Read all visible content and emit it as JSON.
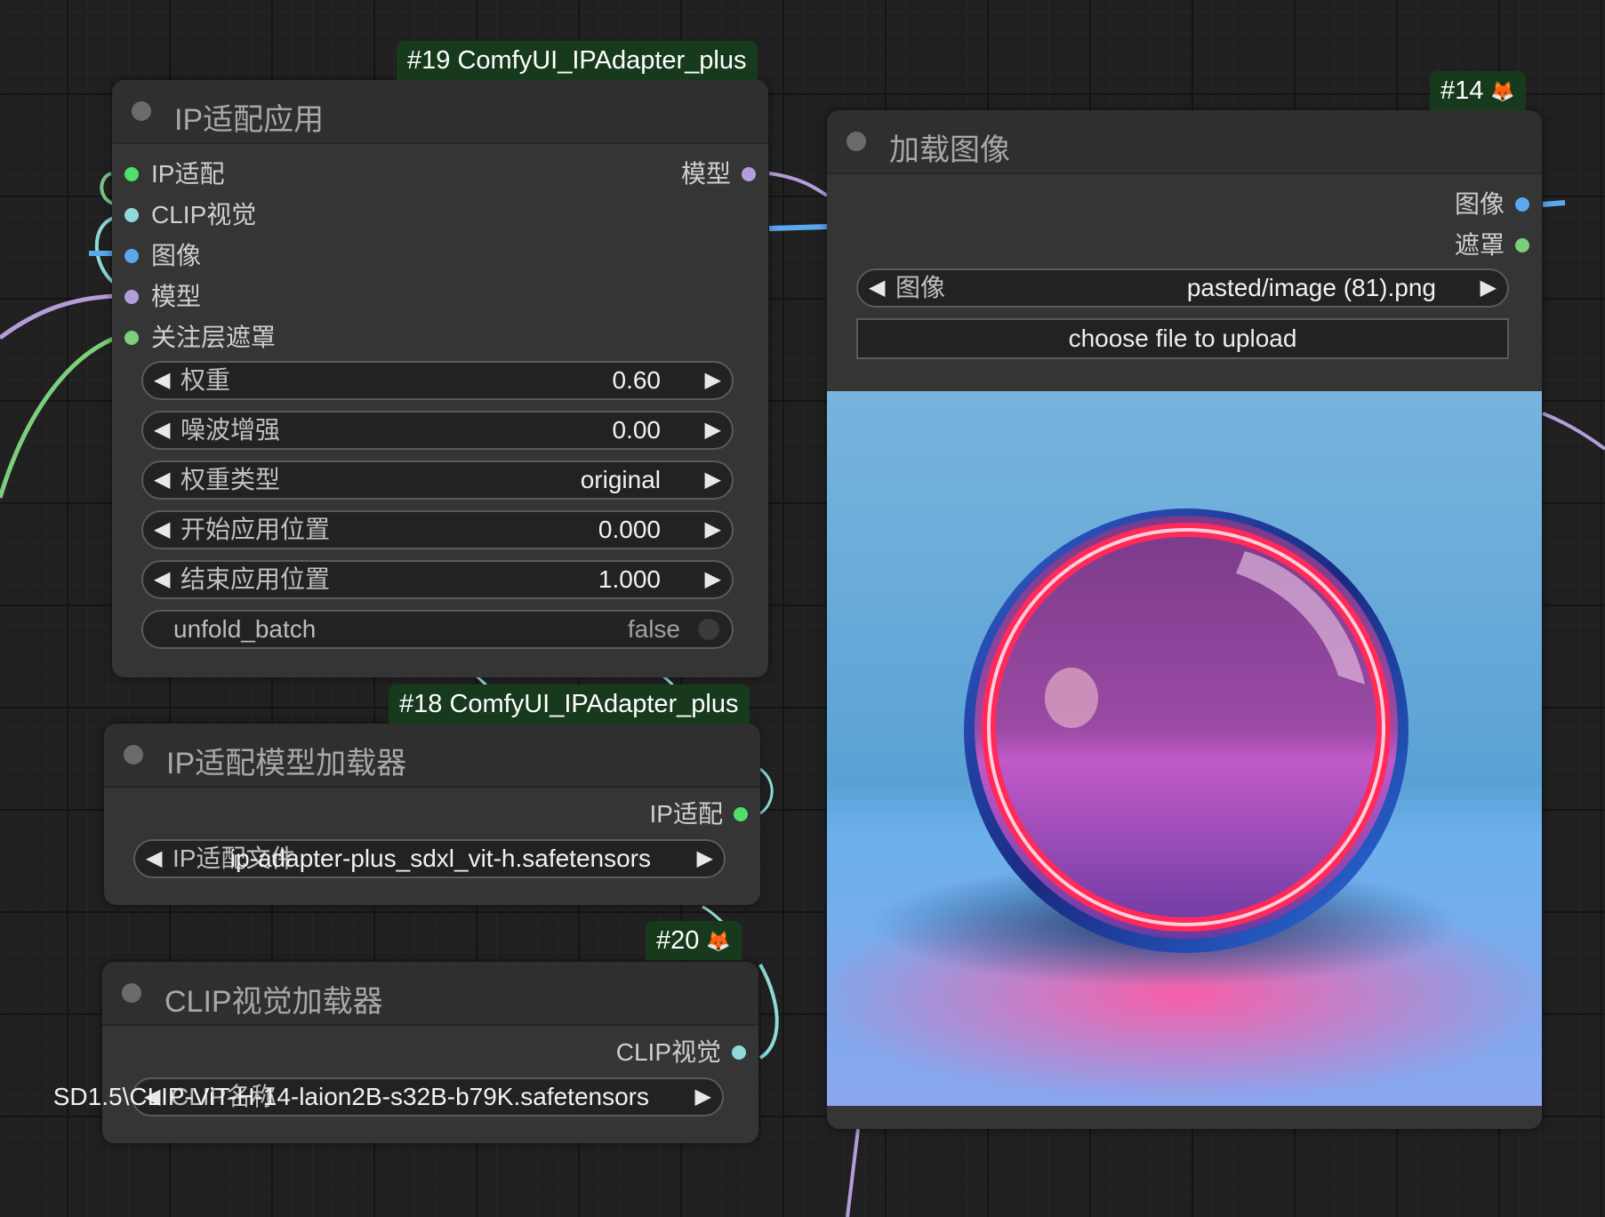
{
  "colors": {
    "canvas_bg": "#202020",
    "node_bg": "#353535",
    "badge_bg": "#17391c",
    "ipadapter_slot": "#4fe06a",
    "clip_vision_slot": "#8fd9d9",
    "image_slot": "#5aa8f0",
    "model_slot": "#b39ddb",
    "mask_slot": "#7ccf7c"
  },
  "node19": {
    "badge": "#19 ComfyUI_IPAdapter_plus",
    "title": "IP适配应用",
    "inputs": [
      "IP适配",
      "CLIP视觉",
      "图像",
      "模型",
      "关注层遮罩"
    ],
    "output": "模型",
    "widgets": [
      {
        "label": "权重",
        "value": "0.60"
      },
      {
        "label": "噪波增强",
        "value": "0.00"
      },
      {
        "label": "权重类型",
        "value": "original"
      },
      {
        "label": "开始应用位置",
        "value": "0.000"
      },
      {
        "label": "结束应用位置",
        "value": "1.000"
      }
    ],
    "toggle": {
      "label": "unfold_batch",
      "value": "false"
    }
  },
  "node18": {
    "badge": "#18 ComfyUI_IPAdapter_plus",
    "title": "IP适配模型加载器",
    "output": "IP适配",
    "widget_label": "IP适配文件",
    "widget_value": "ip-adapter-plus_sdxl_vit-h.safetensors"
  },
  "node20": {
    "badge": "#20",
    "title": "CLIP视觉加载器",
    "output": "CLIP视觉",
    "widget_label": "CLIP名称",
    "widget_value": "SD1.5\\CLIP-ViT-H-14-laion2B-s32B-b79K.safetensors"
  },
  "node14": {
    "badge": "#14",
    "title": "加载图像",
    "outputs": [
      "图像",
      "遮罩"
    ],
    "widget_label": "图像",
    "widget_value": "pasted/image (81).png",
    "upload_label": "choose file to upload"
  },
  "icons": {
    "left_arrow": "◀",
    "right_arrow": "▶",
    "fox_badge_icon": "🦊"
  }
}
